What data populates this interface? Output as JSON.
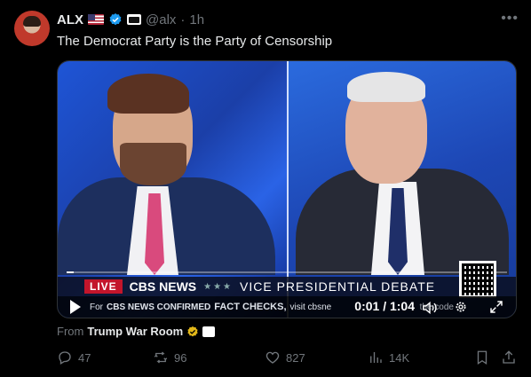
{
  "author": {
    "name": "ALX",
    "handle": "@alx",
    "separator": "·",
    "time": "1h"
  },
  "tweet": {
    "text": "The Democrat Party is the Party of Censorship"
  },
  "video": {
    "ticker_live": "LIVE",
    "ticker_network": "CBS NEWS",
    "ticker_stars": "★★★",
    "ticker_title": "VICE PRESIDENTIAL DEBATE",
    "sub_prefix": "For",
    "sub_network": "CBS NEWS CONFIRMED",
    "sub_facts": "FACT CHECKS,",
    "sub_visit": "visit cbsne",
    "time_readout": "0:01 / 1:04",
    "sub_tail": "the code",
    "progress": 0.016
  },
  "from": {
    "label": "From",
    "source": "Trump War Room"
  },
  "actions": {
    "replies": "47",
    "reposts": "96",
    "likes": "827",
    "views": "14K"
  },
  "colors": {
    "verified": "#1d9bf0",
    "gold": "#e2b719",
    "muted": "#71767b"
  }
}
